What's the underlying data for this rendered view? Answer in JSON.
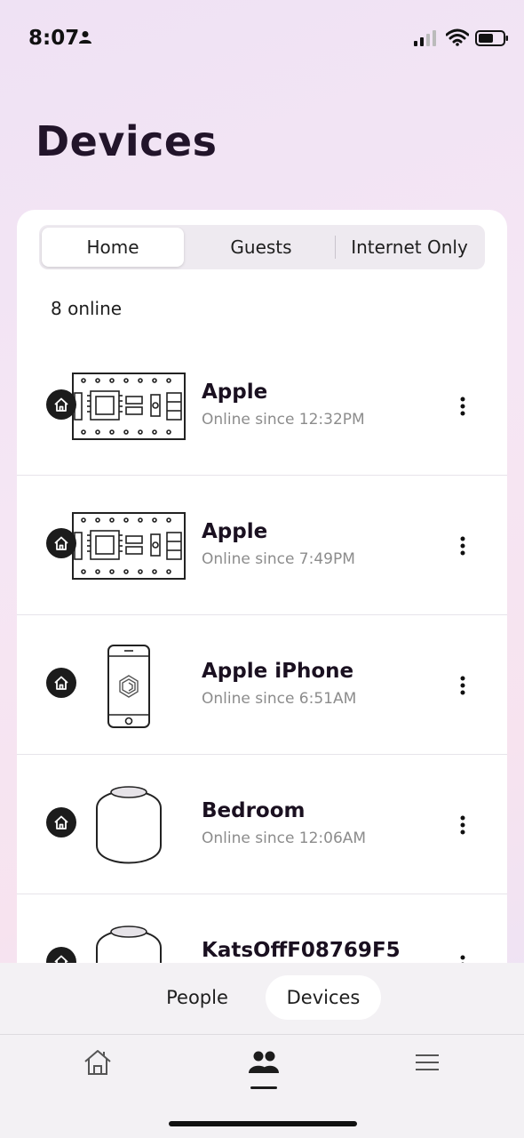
{
  "status_bar": {
    "time": "8:07",
    "icons": [
      "person-icon",
      "signal-icon",
      "wifi-icon",
      "battery-icon"
    ]
  },
  "page": {
    "title": "Devices"
  },
  "segments": [
    {
      "label": "Home",
      "active": true
    },
    {
      "label": "Guests",
      "active": false
    },
    {
      "label": "Internet Only",
      "active": false
    }
  ],
  "online_count": "8 online",
  "devices": [
    {
      "name": "Apple",
      "status": "Online since 12:32PM",
      "icon": "circuit-board-icon"
    },
    {
      "name": "Apple",
      "status": "Online since 7:49PM",
      "icon": "circuit-board-icon"
    },
    {
      "name": "Apple iPhone",
      "status": "Online since 6:51AM",
      "icon": "iphone-icon"
    },
    {
      "name": "Bedroom",
      "status": "Online since 12:06AM",
      "icon": "homepod-icon"
    },
    {
      "name": "KatsOffF08769F5",
      "status": "",
      "icon": "homepod-icon"
    }
  ],
  "sub_tabs": [
    {
      "label": "People",
      "active": false
    },
    {
      "label": "Devices",
      "active": true
    }
  ],
  "tab_bar": [
    {
      "icon": "home-icon",
      "active": false
    },
    {
      "icon": "people-icon",
      "active": true
    },
    {
      "icon": "menu-icon",
      "active": false
    }
  ],
  "colors": {
    "badge": "#1c1c1c",
    "accent_text": "#22142a",
    "muted_text": "#8c8c8c"
  }
}
